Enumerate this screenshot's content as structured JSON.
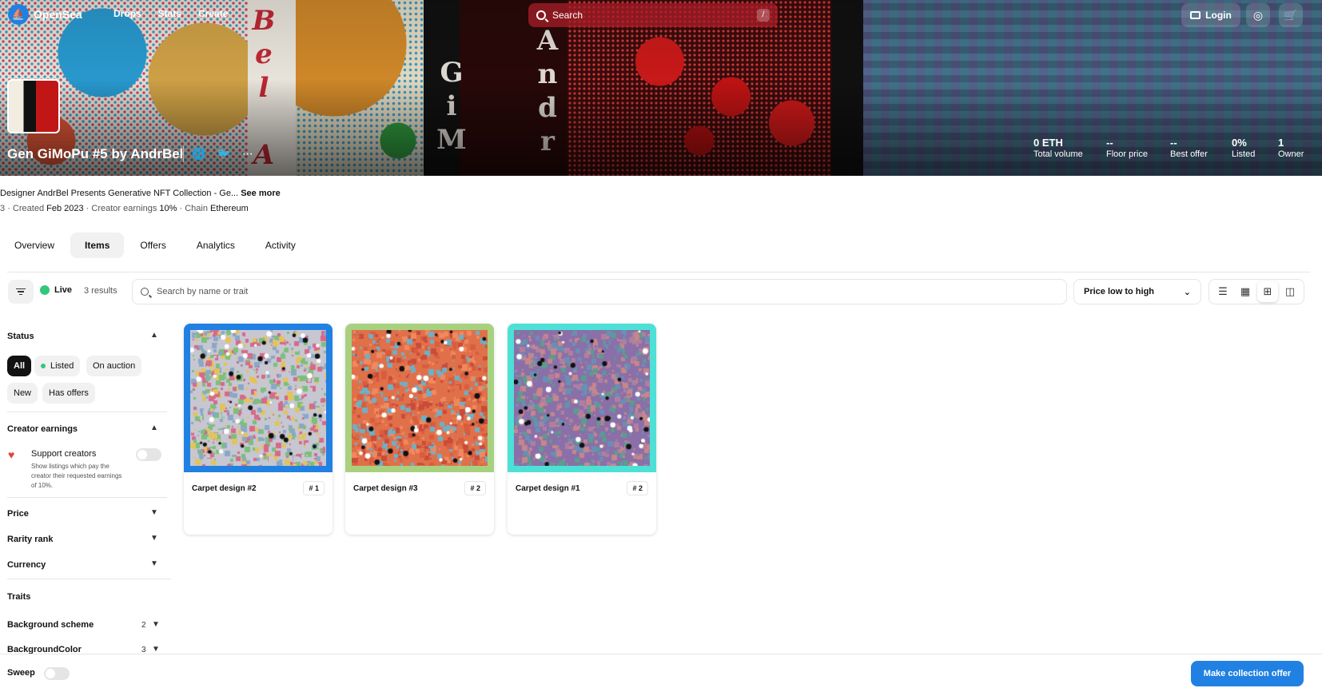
{
  "nav": {
    "brand": "OpenSea",
    "links": [
      "Drops",
      "Stats",
      "Create"
    ],
    "search_placeholder": "Search",
    "search_shortcut": "/",
    "login_label": "Login",
    "profile_icon": "profile-icon",
    "cart_icon": "cart-icon"
  },
  "collection": {
    "title": "Gen GiMoPu #5 by AndrBel",
    "description": "Designer AndrBel Presents Generative NFT Collection  - Ge...",
    "see_more": "See more",
    "items_count": "3",
    "created_label": "Created",
    "created_value": "Feb 2023",
    "earnings_label": "Creator earnings",
    "earnings_value": "10%",
    "chain_label": "Chain",
    "chain_value": "Ethereum",
    "social_icons": [
      "globe-icon",
      "twitter-icon",
      "more-icon"
    ],
    "stats": [
      {
        "value": "0 ETH",
        "label": "Total volume"
      },
      {
        "value": "--",
        "label": "Floor price"
      },
      {
        "value": "--",
        "label": "Best offer"
      },
      {
        "value": "0%",
        "label": "Listed"
      },
      {
        "value": "1",
        "label": "Owner"
      }
    ]
  },
  "tabs": [
    "Overview",
    "Items",
    "Offers",
    "Analytics",
    "Activity"
  ],
  "active_tab": "Items",
  "toolbar": {
    "live_label": "Live",
    "results": "3 results",
    "search_placeholder": "Search by name or trait",
    "sort_value": "Price low to high",
    "view_modes": [
      "list-view-icon",
      "grid-small-icon",
      "grid-medium-icon",
      "grid-large-icon"
    ],
    "active_view": "grid-medium-icon"
  },
  "sidebar": {
    "status": {
      "title": "Status",
      "options": [
        "All",
        "Listed",
        "On auction",
        "New",
        "Has offers"
      ],
      "selected": "All"
    },
    "creator_earnings": {
      "title": "Creator earnings",
      "support_title": "Support creators",
      "support_desc": "Show listings which pay the creator their requested earnings of 10%.",
      "enabled": false
    },
    "filters": [
      "Price",
      "Rarity rank",
      "Currency"
    ],
    "traits": {
      "title": "Traits",
      "items": [
        {
          "name": "Background scheme",
          "count": "2"
        },
        {
          "name": "BackgroundColor",
          "count": "3"
        }
      ]
    }
  },
  "items": [
    {
      "name": "Carpet design #2",
      "rank": "# 1",
      "frame_color": "#2081e2",
      "palette": [
        "#c7c7d1",
        "#8aa7c9",
        "#d66a8a",
        "#7bc07a",
        "#e3c35a"
      ]
    },
    {
      "name": "Carpet design #3",
      "rank": "# 2",
      "frame_color": "#a7d17f",
      "palette": [
        "#e0704a",
        "#d85d3f",
        "#f08a5e",
        "#c94b3a",
        "#6db0c7"
      ]
    },
    {
      "name": "Carpet design #1",
      "rank": "# 2",
      "frame_color": "#4de0d6",
      "palette": [
        "#8a6fa8",
        "#b07fa0",
        "#6a8fb5",
        "#c7868a",
        "#5b9c8e"
      ]
    }
  ],
  "bottom": {
    "sweep_label": "Sweep",
    "offer_button": "Make collection offer"
  }
}
